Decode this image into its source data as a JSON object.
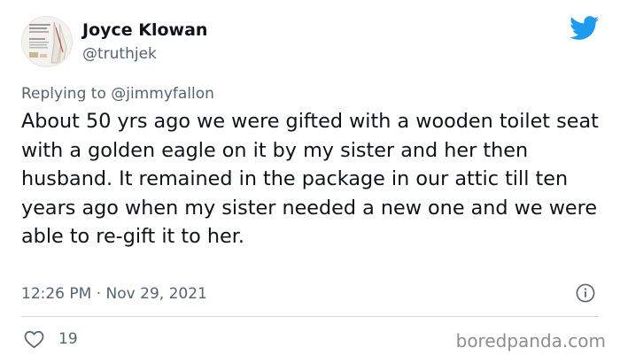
{
  "user": {
    "display_name": "Joyce Klowan",
    "handle": "@truthjek"
  },
  "reply": {
    "prefix": "Replying to",
    "mention": "@jimmyfallon"
  },
  "tweet": {
    "text": "About 50 yrs ago we were gifted with a wooden toilet seat with a golden eagle on it by my sister and her then husband. It remained in the package in our attic till ten years ago when my sister needed a new one and we were able to re-gift it to her.",
    "time": "12:26 PM",
    "separator": "·",
    "date": "Nov 29, 2021"
  },
  "engagement": {
    "likes": "19"
  },
  "watermark": "boredpanda.com",
  "icons": {
    "brand": "twitter-bird-icon",
    "info": "info-icon",
    "like": "heart-icon"
  },
  "colors": {
    "brand_blue": "#1d9bf0",
    "secondary_text": "#536471",
    "primary_text": "#0f1419",
    "divider": "#cfd9de"
  }
}
